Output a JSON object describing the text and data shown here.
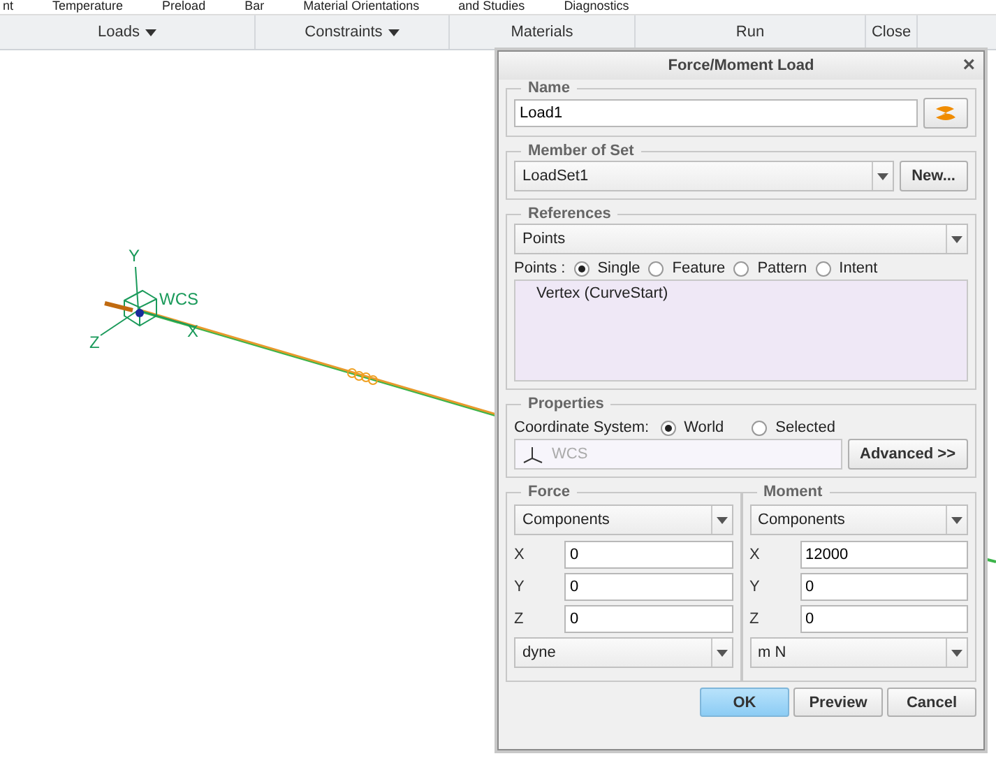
{
  "ribbon": {
    "commands": [
      {
        "label": "nt"
      },
      {
        "label": "Temperature"
      },
      {
        "label": "Preload"
      },
      {
        "label": "Bar"
      },
      {
        "label": "Material Orientations"
      },
      {
        "label": "and Studies"
      },
      {
        "label": "Diagnostics"
      }
    ],
    "groups": [
      {
        "label": "Loads",
        "menu": true
      },
      {
        "label": "Constraints",
        "menu": true
      },
      {
        "label": "Materials",
        "menu": false
      },
      {
        "label": "Run",
        "menu": false
      },
      {
        "label": "Close",
        "menu": false
      }
    ]
  },
  "viewport": {
    "axis_labels": {
      "y": "Y",
      "name": "WCS",
      "x": "X",
      "z": "Z"
    }
  },
  "dialog": {
    "title": "Force/Moment Load",
    "close": "×",
    "name": {
      "legend": "Name",
      "value": "Load1"
    },
    "member_of_set": {
      "legend": "Member of Set",
      "value": "LoadSet1",
      "button": "New..."
    },
    "references": {
      "legend": "References",
      "type": "Points",
      "prefix": "Points :",
      "options": [
        {
          "label": "Single",
          "selected": true
        },
        {
          "label": "Feature",
          "selected": false
        },
        {
          "label": "Pattern",
          "selected": false
        },
        {
          "label": "Intent",
          "selected": false
        }
      ],
      "items": [
        "Vertex (CurveStart)"
      ]
    },
    "properties": {
      "legend": "Properties",
      "label": "Coordinate System:",
      "options": [
        {
          "label": "World",
          "selected": true
        },
        {
          "label": "Selected",
          "selected": false
        }
      ],
      "csys": "WCS",
      "button": "Advanced >>"
    },
    "panels": [
      {
        "legend": "Force",
        "mode": "Components",
        "rows": [
          {
            "axis": "X",
            "value": "0"
          },
          {
            "axis": "Y",
            "value": "0"
          },
          {
            "axis": "Z",
            "value": "0"
          }
        ],
        "unit": "dyne"
      },
      {
        "legend": "Moment",
        "mode": "Components",
        "rows": [
          {
            "axis": "X",
            "value": "12000"
          },
          {
            "axis": "Y",
            "value": "0"
          },
          {
            "axis": "Z",
            "value": "0"
          }
        ],
        "unit": "m N"
      }
    ],
    "buttons": [
      {
        "label": "OK",
        "primary": true
      },
      {
        "label": "Preview",
        "primary": false
      },
      {
        "label": "Cancel",
        "primary": false
      }
    ]
  }
}
